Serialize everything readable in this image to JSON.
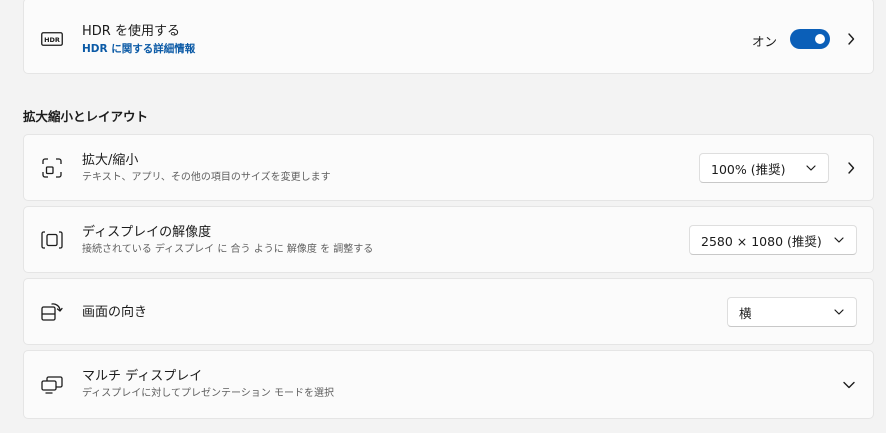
{
  "hdr": {
    "icon": "hdr-icon",
    "icon_text": "HDR",
    "title": "HDR を使用する",
    "link": "HDR に関する詳細情報",
    "toggle_label": "オン",
    "toggle_on": true,
    "accent_color": "#0b5fb8"
  },
  "section": {
    "heading": "拡大縮小とレイアウト"
  },
  "scale": {
    "icon": "scale-icon",
    "title": "拡大/縮小",
    "description": "テキスト、アプリ、その他の項目のサイズを変更します",
    "value": "100% (推奨)"
  },
  "resolution": {
    "icon": "resolution-icon",
    "title": "ディスプレイの解像度",
    "description": "接続されている ディスプレイ に 合う ように 解像度 を 調整する",
    "value": "2580 × 1080 (推奨)"
  },
  "orientation": {
    "icon": "orientation-icon",
    "title": "画面の向き",
    "value": "横"
  },
  "multi": {
    "icon": "multi-display-icon",
    "title": "マルチ ディスプレイ",
    "description": "ディスプレイに対してプレゼンテーション モードを選択"
  }
}
